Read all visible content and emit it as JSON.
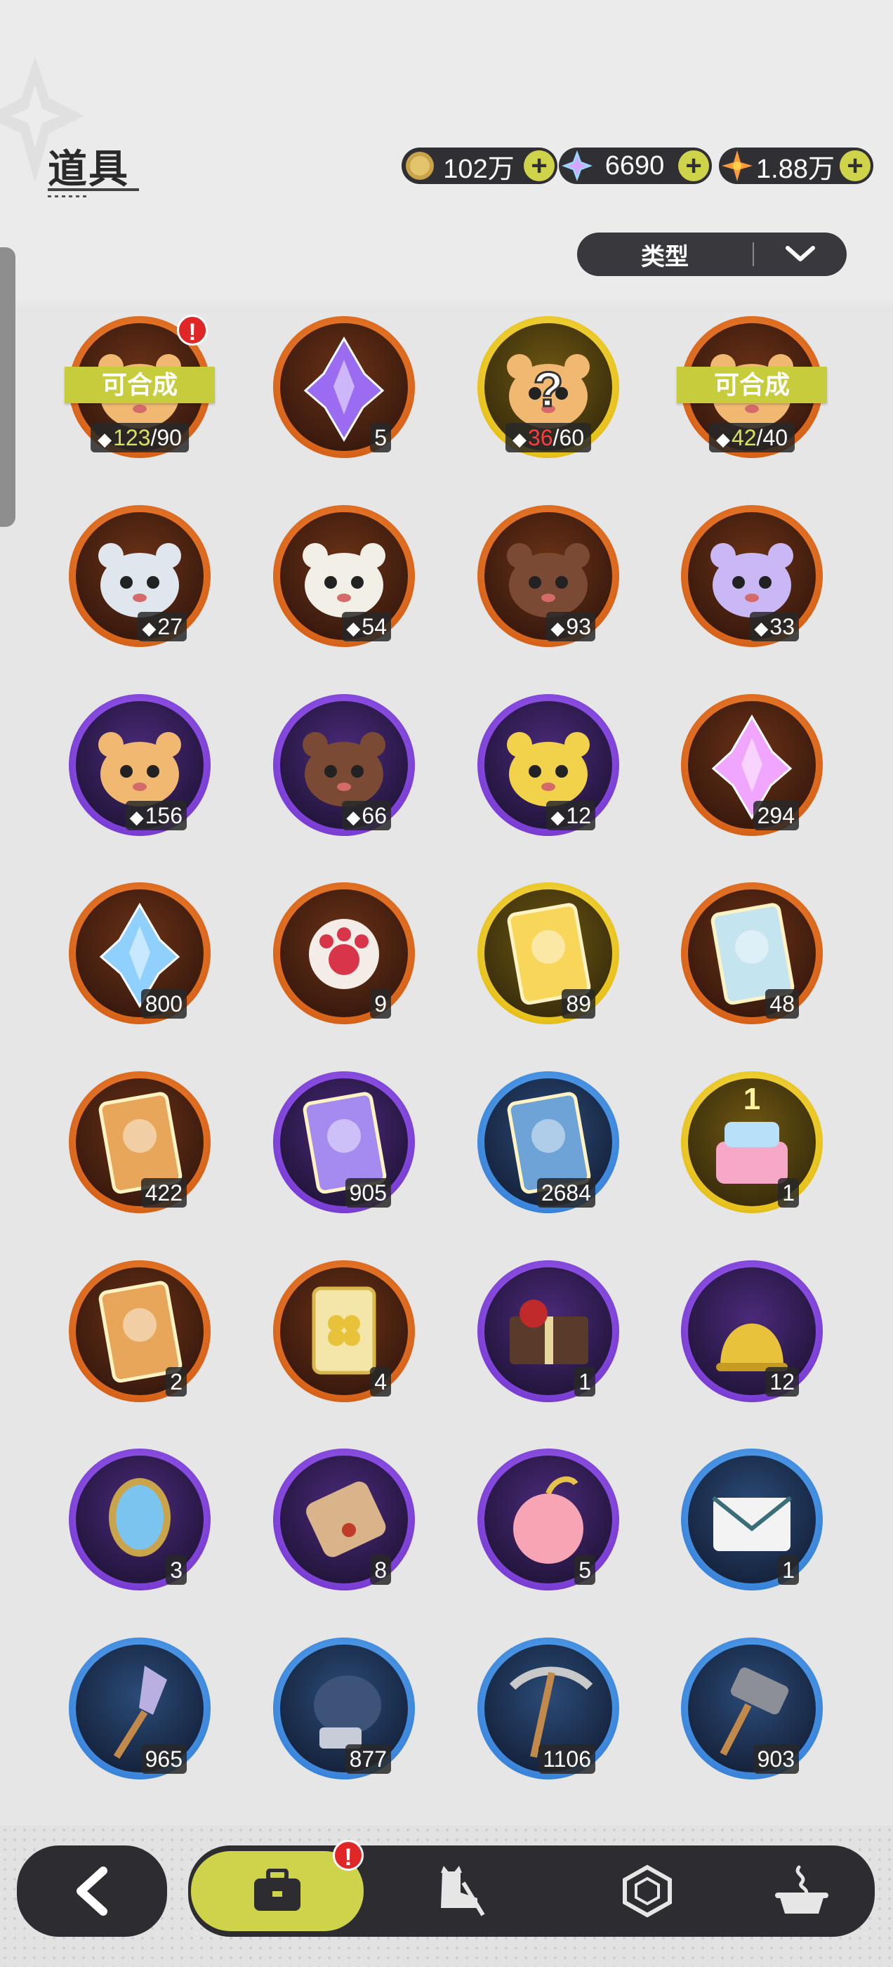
{
  "header": {
    "title": "道具"
  },
  "currencies": [
    {
      "name": "coin-icon",
      "value": "102万"
    },
    {
      "name": "crystal-icon",
      "value": "6690"
    },
    {
      "name": "star-icon",
      "value": "1.88万"
    }
  ],
  "filter": {
    "label": "类型"
  },
  "items": [
    {
      "icon": "hamster-orange-icon",
      "rarity": "orange",
      "banner": "可合成",
      "have": "123",
      "need": "/90",
      "need_color": "g",
      "alert": "!"
    },
    {
      "icon": "purple-crystal-clock-icon",
      "rarity": "orange",
      "count": "5"
    },
    {
      "icon": "mystery-hamster-icon",
      "rarity": "gold",
      "have": "36",
      "need": "/60",
      "need_color": "r"
    },
    {
      "icon": "hamster-orange-2-icon",
      "rarity": "orange",
      "banner": "可合成",
      "have": "42",
      "need": "/40",
      "need_color": "g"
    },
    {
      "icon": "knight-hamster-icon",
      "rarity": "orange",
      "count": "27",
      "puzzle": true
    },
    {
      "icon": "panda-hamster-icon",
      "rarity": "orange",
      "count": "54",
      "puzzle": true
    },
    {
      "icon": "pirate-hamster-icon",
      "rarity": "orange",
      "count": "93",
      "puzzle": true
    },
    {
      "icon": "lavender-hamster-icon",
      "rarity": "orange",
      "count": "33",
      "puzzle": true
    },
    {
      "icon": "leaf-hamster-icon",
      "rarity": "purple",
      "count": "156",
      "puzzle": true
    },
    {
      "icon": "bear-hamster-icon",
      "rarity": "purple",
      "count": "66",
      "puzzle": true
    },
    {
      "icon": "yellow-hamster-icon",
      "rarity": "purple",
      "count": "12",
      "puzzle": true
    },
    {
      "icon": "pink-star-crystal-icon",
      "rarity": "orange",
      "count": "294"
    },
    {
      "icon": "blue-star-crystal-icon",
      "rarity": "orange",
      "count": "800"
    },
    {
      "icon": "paw-charm-icon",
      "rarity": "orange",
      "count": "9"
    },
    {
      "icon": "gold-character-card-icon",
      "rarity": "gold",
      "count": "89"
    },
    {
      "icon": "rainbow-character-card-icon",
      "rarity": "orange",
      "count": "48"
    },
    {
      "icon": "orange-character-card-icon",
      "rarity": "orange",
      "count": "422"
    },
    {
      "icon": "purple-character-card-icon",
      "rarity": "purple",
      "count": "905"
    },
    {
      "icon": "blue-character-card-icon",
      "rarity": "blue",
      "count": "2684"
    },
    {
      "icon": "birthday-cake-icon",
      "rarity": "gold",
      "count": "1"
    },
    {
      "icon": "refresh-card-icon",
      "rarity": "orange",
      "count": "2"
    },
    {
      "icon": "clover-ticket-icon",
      "rarity": "orange",
      "count": "4"
    },
    {
      "icon": "gift-box-icon",
      "rarity": "purple",
      "count": "1"
    },
    {
      "icon": "golden-bell-icon",
      "rarity": "purple",
      "count": "12"
    },
    {
      "icon": "magic-mirror-icon",
      "rarity": "purple",
      "count": "3"
    },
    {
      "icon": "scroll-icon",
      "rarity": "purple",
      "count": "8"
    },
    {
      "icon": "pink-apple-icon",
      "rarity": "purple",
      "count": "5"
    },
    {
      "icon": "envelope-icon",
      "rarity": "blue",
      "count": "1"
    },
    {
      "icon": "shovel-icon",
      "rarity": "blue",
      "count": "965"
    },
    {
      "icon": "glove-icon",
      "rarity": "blue",
      "count": "877"
    },
    {
      "icon": "pickaxe-icon",
      "rarity": "blue",
      "count": "1106"
    },
    {
      "icon": "hammer-icon",
      "rarity": "blue",
      "count": "903"
    }
  ],
  "nav": {
    "back": "back-arrow-icon",
    "tabs": [
      "bag-icon",
      "cat-boot-icon",
      "hexagon-icon",
      "pot-icon"
    ],
    "active_badge": "!"
  },
  "colors": {
    "accent": "#cfd34a",
    "dark": "#2d2d31",
    "alert": "#e02626"
  }
}
